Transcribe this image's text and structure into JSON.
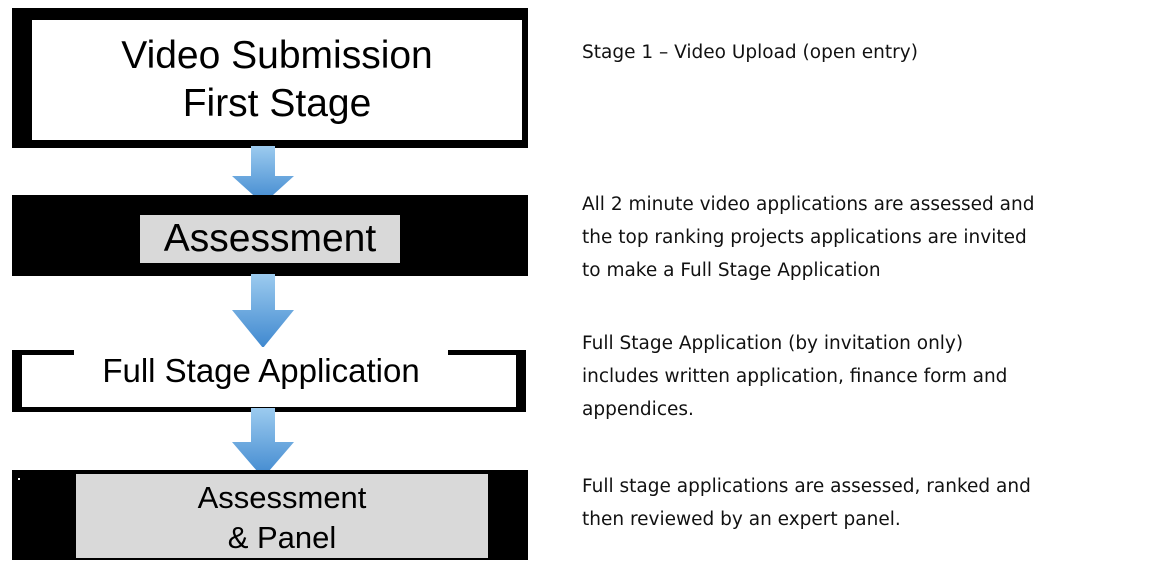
{
  "diagram": {
    "stages": [
      {
        "label_lines": [
          "Video Submission",
          "First Stage"
        ]
      },
      {
        "label": "Assessment"
      },
      {
        "label": "Full Stage Application"
      },
      {
        "label_lines": [
          "Assessment",
          "& Panel"
        ]
      }
    ],
    "descriptions": [
      {
        "lines": [
          "Stage 1 – Video Upload (open entry)"
        ]
      },
      {
        "lines": [
          "All 2 minute video applications are assessed and",
          "the top ranking projects applications are invited",
          "to make a Full Stage Application"
        ]
      },
      {
        "lines": [
          "Full Stage Application (by invitation only)",
          "includes written application, finance form and",
          "appendices."
        ]
      },
      {
        "lines": [
          "Full stage applications are assessed, ranked and",
          "then reviewed by an expert panel."
        ]
      }
    ],
    "colors": {
      "arrow_light": "#8fc3ea",
      "arrow_dark": "#3f88cf",
      "box_fill_grey": "#d9d9d9",
      "frame": "#000000"
    }
  }
}
